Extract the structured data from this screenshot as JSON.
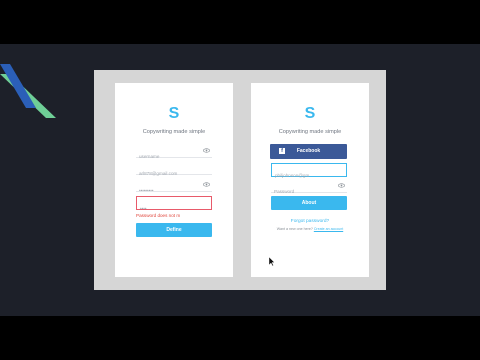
{
  "brand": {
    "logo_letter": "S",
    "tagline": "Copywriting made simple"
  },
  "left_card": {
    "username_placeholder": "username",
    "email_value": "arl878@gmail.com",
    "password_value": "•••••••••",
    "confirm_value": "••••",
    "error_message": "Password does not m",
    "submit_label": "Define"
  },
  "right_card": {
    "facebook_label": "Facebook",
    "email_value": "philjohnson@gm",
    "password_placeholder": "Password",
    "submit_label": "About",
    "forgot_label": "Forgot password?",
    "signup_prefix": "Want a new one here?",
    "signup_link": "Create an account"
  },
  "colors": {
    "accent": "#3ab8ee",
    "facebook": "#3b5998",
    "error": "#e0463c"
  }
}
